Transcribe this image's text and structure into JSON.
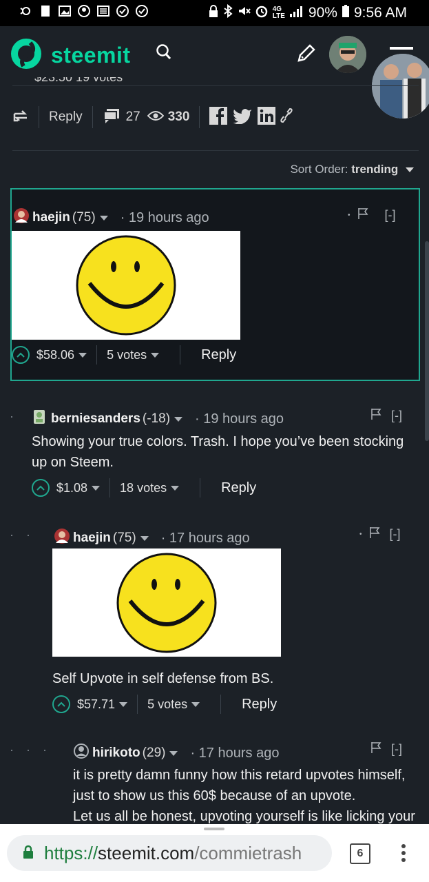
{
  "status_bar": {
    "battery": "90%",
    "time": "9:56 AM",
    "network": "4G LTE"
  },
  "header": {
    "brand": "steemit"
  },
  "post_actions": {
    "reply_label": "Reply",
    "comments_count": "27",
    "views_count": "330",
    "cut_text": "$23.50   19 votes"
  },
  "sort": {
    "label": "Sort Order:",
    "value": "trending"
  },
  "comments": [
    {
      "author": "haejin",
      "reputation": "(75)",
      "time": "· 19 hours ago",
      "payout": "$58.06",
      "votes": "5 votes",
      "reply": "Reply",
      "collapse": "[-]"
    },
    {
      "author": "berniesanders",
      "reputation": "(-18)",
      "time": "· 19 hours ago",
      "text": "Showing your true colors. Trash. I hope you’ve been stocking up on Steem.",
      "payout": "$1.08",
      "votes": "18 votes",
      "reply": "Reply",
      "collapse": "[-]"
    },
    {
      "author": "haejin",
      "reputation": "(75)",
      "time": "· 17 hours ago",
      "text": "Self Upvote in self defense from BS.",
      "payout": "$57.71",
      "votes": "5 votes",
      "reply": "Reply",
      "collapse": "[-]"
    },
    {
      "author": "hirikoto",
      "reputation": "(29)",
      "time": "· 17 hours ago",
      "text_lines": [
        "it is pretty damn funny how this retard upvotes himself,",
        "just to show us this 60$ because of an upvote.",
        "Let us all be honest, upvoting yourself is like licking your"
      ],
      "collapse": "[-]"
    }
  ],
  "url_bar": {
    "scheme": "https://",
    "host": "steemit.com",
    "path": "/commietrash",
    "tab_count": "6"
  },
  "colors": {
    "accent": "#20a78f",
    "brand": "#07d6a0",
    "background": "#1c2127"
  }
}
